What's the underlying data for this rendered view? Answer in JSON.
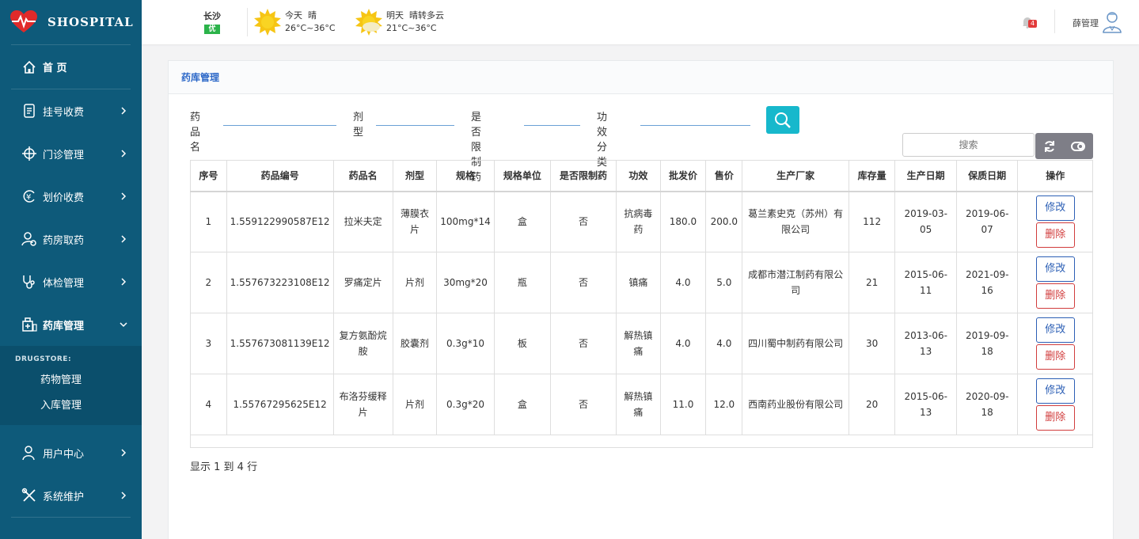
{
  "brand": {
    "name": "SHOSPITAL"
  },
  "sidebar": {
    "home": "首 页",
    "items": [
      {
        "label": "挂号收费",
        "icon": "receipt-icon"
      },
      {
        "label": "门诊管理",
        "icon": "crosshair-icon"
      },
      {
        "label": "划价收费",
        "icon": "yen-icon"
      },
      {
        "label": "药房取药",
        "icon": "user-pharmacy-icon"
      },
      {
        "label": "体检管理",
        "icon": "stethoscope-icon"
      },
      {
        "label": "药库管理",
        "icon": "drugstore-icon"
      }
    ],
    "submenu": {
      "caption": "DRUGSTORE:",
      "items": [
        "药物管理",
        "入库管理"
      ]
    },
    "bottom_items": [
      {
        "label": "用户中心",
        "icon": "user-icon"
      },
      {
        "label": "系统维护",
        "icon": "tools-icon"
      }
    ]
  },
  "topbar": {
    "city": "长沙",
    "aqi": "优",
    "today": {
      "label": "今天",
      "cond": "晴",
      "temp": "26°C~36°C"
    },
    "tomorrow": {
      "label": "明天",
      "cond": "晴转多云",
      "temp": "21°C~36°C"
    },
    "notifications": "4",
    "user": "薛管理"
  },
  "panel": {
    "title": "药库管理",
    "filters": [
      {
        "label": "药品名"
      },
      {
        "label": "剂型"
      },
      {
        "label": "是否限制药"
      },
      {
        "label": "功效分类"
      }
    ],
    "search_placeholder": "搜索",
    "columns": [
      "序号",
      "药品编号",
      "药品名",
      "剂型",
      "规格",
      "规格单位",
      "是否限制药",
      "功效",
      "批发价",
      "售价",
      "生产厂家",
      "库存量",
      "生产日期",
      "保质日期",
      "操作"
    ],
    "rows": [
      [
        "1",
        "1.559122990587E12",
        "拉米夫定",
        "薄膜衣片",
        "100mg*14",
        "盒",
        "否",
        "抗病毒药",
        "180.0",
        "200.0",
        "葛兰素史克（苏州）有限公司",
        "112",
        "2019-03-05",
        "2019-06-07"
      ],
      [
        "2",
        "1.557673223108E12",
        "罗痛定片",
        "片剂",
        "30mg*20",
        "瓶",
        "否",
        "镇痛",
        "4.0",
        "5.0",
        "成都市潜江制药有限公司",
        "21",
        "2015-06-11",
        "2021-09-16"
      ],
      [
        "3",
        "1.557673081139E12",
        "复方氨酚烷胺",
        "胶囊剂",
        "0.3g*10",
        "板",
        "否",
        "解热镇痛",
        "4.0",
        "4.0",
        "四川蜀中制药有限公司",
        "30",
        "2013-06-13",
        "2019-09-18"
      ],
      [
        "4",
        "1.55767295625E12",
        "布洛芬缓释片",
        "片剂",
        "0.3g*20",
        "盒",
        "否",
        "解热镇痛",
        "11.0",
        "12.0",
        "西南药业股份有限公司",
        "20",
        "2015-06-13",
        "2020-09-18"
      ]
    ],
    "edit_label": "修改",
    "delete_label": "删除",
    "footer": "显示 1 到 4 行"
  },
  "colors": {
    "sidebar": "#0e5a7a",
    "accent": "#17b8cc",
    "edit": "#2c5fb5",
    "delete": "#d13c3c"
  }
}
